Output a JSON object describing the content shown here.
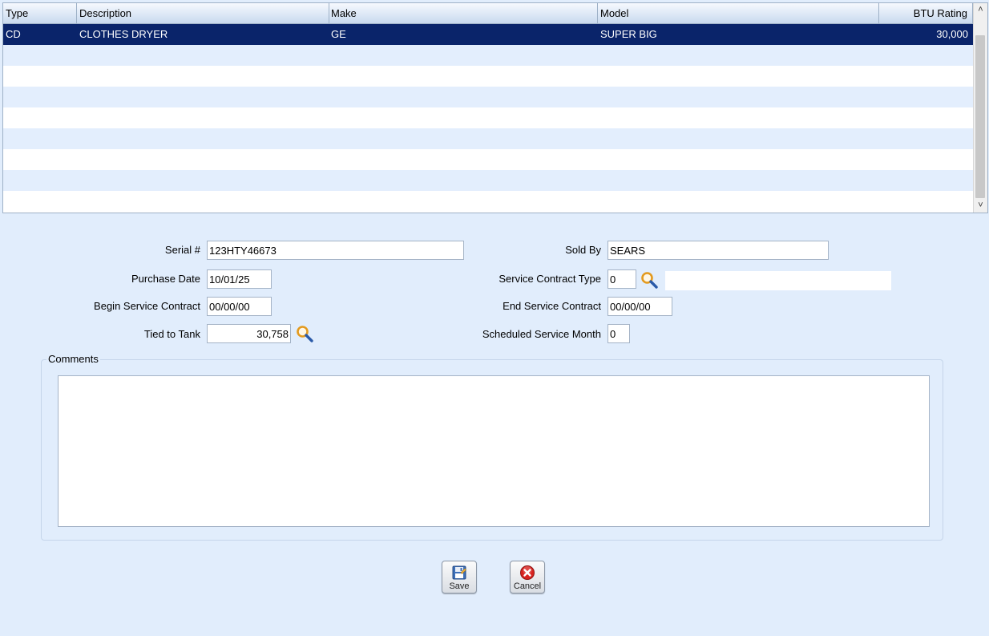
{
  "grid": {
    "columns": [
      {
        "label": "Type"
      },
      {
        "label": "Description"
      },
      {
        "label": "Make"
      },
      {
        "label": "Model"
      },
      {
        "label": "BTU Rating"
      }
    ],
    "rows": [
      {
        "type": "CD",
        "description": "CLOTHES DRYER",
        "make": "GE",
        "model": "SUPER BIG",
        "btu": "30,000"
      }
    ]
  },
  "form": {
    "serial_label": "Serial #",
    "serial_value": "123HTY46673",
    "purchase_date_label": "Purchase Date",
    "purchase_date_value": "10/01/25",
    "begin_contract_label": "Begin Service Contract",
    "begin_contract_value": "00/00/00",
    "tied_tank_label": "Tied to Tank",
    "tied_tank_value": "30,758",
    "sold_by_label": "Sold By",
    "sold_by_value": "SEARS",
    "contract_type_label": "Service Contract Type",
    "contract_type_value": "0",
    "contract_type_desc": "",
    "end_contract_label": "End Service Contract",
    "end_contract_value": "00/00/00",
    "sched_month_label": "Scheduled Service Month",
    "sched_month_value": "0"
  },
  "comments": {
    "legend": "Comments",
    "value": ""
  },
  "actions": {
    "save_label": "Save",
    "cancel_label": "Cancel"
  },
  "colors": {
    "background": "#e1edfc",
    "selected_row": "#0a246a",
    "alt_row": "#e3eefd",
    "lookup_icon": "#e39a1e"
  },
  "icons": {
    "lookup": "magnifier-icon",
    "save": "floppy-save-icon",
    "cancel": "red-x-icon"
  }
}
